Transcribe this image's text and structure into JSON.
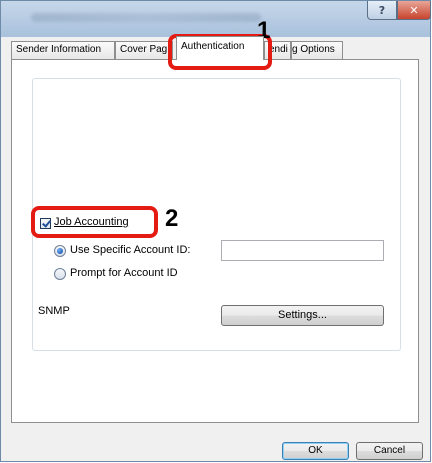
{
  "window": {
    "help_glyph": "?",
    "close_glyph": "✕"
  },
  "tabs": [
    {
      "label": "Sender Information",
      "active": false
    },
    {
      "label": "Cover Pag",
      "active": false
    },
    {
      "label": "Authentication",
      "active": true
    },
    {
      "label": "endi",
      "active": false
    },
    {
      "label": "g Options",
      "active": false
    }
  ],
  "authentication": {
    "job_accounting": {
      "label": "Job Accounting",
      "checked": true
    },
    "use_specific_id": {
      "label": "Use Specific Account ID:",
      "selected": true
    },
    "account_id_value": "",
    "prompt_for_id": {
      "label": "Prompt for Account ID",
      "selected": false
    },
    "snmp_label": "SNMP",
    "settings_button": "Settings..."
  },
  "footer": {
    "ok_label": "OK",
    "cancel_label": "Cancel"
  },
  "annotations": {
    "step1": "1",
    "step2": "2",
    "callout_color": "#e41b13"
  },
  "colors": {
    "titlebar": "#a9c1dc",
    "close_button": "#c8442d"
  }
}
